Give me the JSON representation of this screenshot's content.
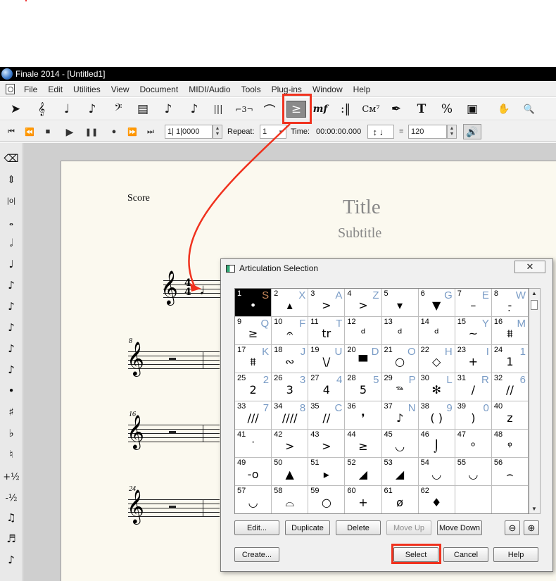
{
  "window": {
    "title": "Finale 2014 - [Untitled1]"
  },
  "menu": [
    "File",
    "Edit",
    "Utilities",
    "View",
    "Document",
    "MIDI/Audio",
    "Tools",
    "Plug-ins",
    "Window",
    "Help"
  ],
  "main_tools": [
    {
      "name": "selection-tool-icon",
      "glyph": "➤"
    },
    {
      "name": "staff-tool-icon",
      "glyph": "𝄞"
    },
    {
      "name": "simple-entry-icon",
      "glyph": "♩"
    },
    {
      "name": "speedy-entry-icon",
      "glyph": "♪"
    },
    {
      "name": "key-signature-icon",
      "glyph": "𝄢"
    },
    {
      "name": "measure-tool-icon",
      "glyph": "▤"
    },
    {
      "name": "note-entry-icon",
      "glyph": "♪"
    },
    {
      "name": "eighth-note-icon",
      "glyph": "♪"
    },
    {
      "name": "mirror-tool-icon",
      "glyph": "|||"
    },
    {
      "name": "tuplet-tool-icon",
      "glyph": "⌐3¬"
    },
    {
      "name": "smart-shape-icon",
      "glyph": "⌒"
    },
    {
      "name": "articulation-tool-icon",
      "glyph": "≥"
    },
    {
      "name": "expression-tool-icon",
      "glyph": "mf"
    },
    {
      "name": "repeat-tool-icon",
      "glyph": ":‖"
    },
    {
      "name": "chord-tool-icon",
      "glyph": "Cᴍ⁷"
    },
    {
      "name": "lyrics-tool-icon",
      "glyph": "✒"
    },
    {
      "name": "text-tool-icon",
      "glyph": "T"
    },
    {
      "name": "resize-tool-icon",
      "glyph": "%"
    },
    {
      "name": "page-layout-icon",
      "glyph": "▣"
    },
    {
      "name": "hand-grabber-icon",
      "glyph": "✋"
    },
    {
      "name": "zoom-tool-icon",
      "glyph": "🔍"
    }
  ],
  "playback": {
    "counter": "1| 1|0000",
    "repeat_label": "Repeat:",
    "repeat_value": "1",
    "time_label": "Time:",
    "time_value": "00:00:00.000",
    "equals": "=",
    "tempo": "120"
  },
  "palette_tools": [
    {
      "name": "eraser-icon",
      "glyph": "⌫"
    },
    {
      "name": "half-step-icon",
      "glyph": "⇕"
    },
    {
      "name": "double-whole-icon",
      "glyph": "|o|"
    },
    {
      "name": "whole-note-icon",
      "glyph": "𝅝"
    },
    {
      "name": "half-note-icon",
      "glyph": "𝅗𝅥"
    },
    {
      "name": "quarter-note-icon",
      "glyph": "♩"
    },
    {
      "name": "eighth-note-icon",
      "glyph": "♪"
    },
    {
      "name": "sixteenth-note-icon",
      "glyph": "♪"
    },
    {
      "name": "thirty-second-icon",
      "glyph": "♪"
    },
    {
      "name": "sixty-fourth-icon",
      "glyph": "♪"
    },
    {
      "name": "128th-note-icon",
      "glyph": "♪"
    },
    {
      "name": "dot-icon",
      "glyph": "•"
    },
    {
      "name": "sharp-icon",
      "glyph": "♯"
    },
    {
      "name": "flat-icon",
      "glyph": "♭"
    },
    {
      "name": "natural-icon",
      "glyph": "♮"
    },
    {
      "name": "half-step-up-icon",
      "glyph": "+½"
    },
    {
      "name": "half-step-down-icon",
      "glyph": "-½"
    },
    {
      "name": "tie-icon",
      "glyph": "♫"
    },
    {
      "name": "tuplet-icon",
      "glyph": "♬"
    },
    {
      "name": "grace-note-icon",
      "glyph": "♪"
    }
  ],
  "score": {
    "label": "Score",
    "title": "Title",
    "subtitle": "Subtitle",
    "measure_numbers": [
      "8",
      "16",
      "24"
    ]
  },
  "dialog": {
    "title": "Articulation Selection",
    "close": "✕",
    "cells": [
      {
        "n": "1",
        "k": "S",
        "s": "•"
      },
      {
        "n": "2",
        "k": "X",
        "s": "▴"
      },
      {
        "n": "3",
        "k": "A",
        "s": ">"
      },
      {
        "n": "4",
        "k": "Z",
        "s": ">"
      },
      {
        "n": "5",
        "k": "",
        "s": "▾"
      },
      {
        "n": "6",
        "k": "G",
        "s": "▼"
      },
      {
        "n": "7",
        "k": "E",
        "s": "–"
      },
      {
        "n": "8",
        "k": "W",
        "s": "-̣"
      },
      {
        "n": "9",
        "k": "Q",
        "s": "≥"
      },
      {
        "n": "10",
        "k": "F",
        "s": "𝄐"
      },
      {
        "n": "11",
        "k": "T",
        "s": "tr"
      },
      {
        "n": "12",
        "k": "",
        "s": "ᵈ"
      },
      {
        "n": "13",
        "k": "",
        "s": "ᵈ"
      },
      {
        "n": "14",
        "k": "",
        "s": "ᵈ"
      },
      {
        "n": "15",
        "k": "Y",
        "s": "~"
      },
      {
        "n": "16",
        "k": "M",
        "s": "⩩"
      },
      {
        "n": "17",
        "k": "K",
        "s": "⩩"
      },
      {
        "n": "18",
        "k": "J",
        "s": "∾"
      },
      {
        "n": "19",
        "k": "U",
        "s": "\\/"
      },
      {
        "n": "20",
        "k": "D",
        "s": "▀"
      },
      {
        "n": "21",
        "k": "O",
        "s": "○"
      },
      {
        "n": "22",
        "k": "H",
        "s": "◇"
      },
      {
        "n": "23",
        "k": "I",
        "s": "+"
      },
      {
        "n": "24",
        "k": "1",
        "s": "1"
      },
      {
        "n": "25",
        "k": "2",
        "s": "2"
      },
      {
        "n": "26",
        "k": "3",
        "s": "3"
      },
      {
        "n": "27",
        "k": "4",
        "s": "4"
      },
      {
        "n": "28",
        "k": "5",
        "s": "5"
      },
      {
        "n": "29",
        "k": "P",
        "s": "𝆮"
      },
      {
        "n": "30",
        "k": "L",
        "s": "✻"
      },
      {
        "n": "31",
        "k": "R",
        "s": "/"
      },
      {
        "n": "32",
        "k": "6",
        "s": "//"
      },
      {
        "n": "33",
        "k": "7",
        "s": "///"
      },
      {
        "n": "34",
        "k": "8",
        "s": "////"
      },
      {
        "n": "35",
        "k": "C",
        "s": "//"
      },
      {
        "n": "36",
        "k": "",
        "s": "❜"
      },
      {
        "n": "37",
        "k": "N",
        "s": "♪"
      },
      {
        "n": "38",
        "k": "9",
        "s": "( )"
      },
      {
        "n": "39",
        "k": "0",
        "s": ")"
      },
      {
        "n": "40",
        "k": "",
        "s": "z"
      },
      {
        "n": "41",
        "k": "",
        "s": "˙"
      },
      {
        "n": "42",
        "k": "",
        "s": ">"
      },
      {
        "n": "43",
        "k": "",
        "s": ">"
      },
      {
        "n": "44",
        "k": "",
        "s": "≥"
      },
      {
        "n": "45",
        "k": "",
        "s": "◡"
      },
      {
        "n": "46",
        "k": "",
        "s": "⌡"
      },
      {
        "n": "47",
        "k": "",
        "s": "ᵒ"
      },
      {
        "n": "48",
        "k": "",
        "s": "ᵠ"
      },
      {
        "n": "49",
        "k": "",
        "s": "-o"
      },
      {
        "n": "50",
        "k": "",
        "s": "▲"
      },
      {
        "n": "51",
        "k": "",
        "s": "▸"
      },
      {
        "n": "52",
        "k": "",
        "s": "◢"
      },
      {
        "n": "53",
        "k": "",
        "s": "◢"
      },
      {
        "n": "54",
        "k": "",
        "s": "◡"
      },
      {
        "n": "55",
        "k": "",
        "s": "◡"
      },
      {
        "n": "56",
        "k": "",
        "s": "⌢"
      },
      {
        "n": "57",
        "k": "",
        "s": "◡"
      },
      {
        "n": "58",
        "k": "",
        "s": "⌓"
      },
      {
        "n": "59",
        "k": "",
        "s": "○"
      },
      {
        "n": "60",
        "k": "",
        "s": "+"
      },
      {
        "n": "61",
        "k": "",
        "s": "ø"
      },
      {
        "n": "62",
        "k": "",
        "s": "♦"
      },
      {
        "n": "",
        "k": "",
        "s": ""
      },
      {
        "n": "",
        "k": "",
        "s": ""
      }
    ],
    "buttons": {
      "edit": "Edit...",
      "duplicate": "Duplicate",
      "delete": "Delete",
      "move_up": "Move Up",
      "move_down": "Move Down",
      "create": "Create...",
      "select": "Select",
      "cancel": "Cancel",
      "help": "Help"
    }
  },
  "colors": {
    "highlight": "#f0321e",
    "paper": "#fbf9ef",
    "shortcut_key": "#7a9cc6"
  }
}
